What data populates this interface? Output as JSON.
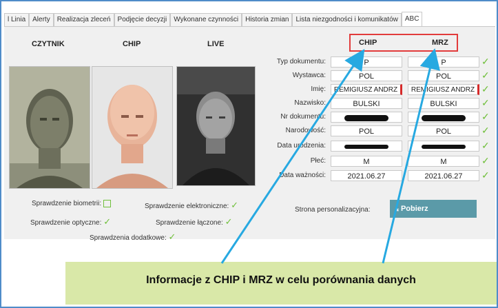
{
  "tabs": [
    "l Linia",
    "Alerty",
    "Realizacja zleceń",
    "Podjęcie decyzji",
    "Wykonane czynności",
    "Historia zmian",
    "Lista niezgodności i komunikatów",
    "ABC"
  ],
  "columns": {
    "czytnik": "CZYTNIK",
    "chip": "CHIP",
    "live": "LIVE"
  },
  "compare_headers": {
    "chip": "CHIP",
    "mrz": "MRZ"
  },
  "fields": [
    {
      "label": "Typ dokumentu:",
      "chip": "P",
      "mrz": "P",
      "redacted": false
    },
    {
      "label": "Wystawca:",
      "chip": "POL",
      "mrz": "POL",
      "redacted": false
    },
    {
      "label": "Imię:",
      "chip": "REMIGIUSZ ANDRZ",
      "mrz": "REMIGIUSZ ANDRZ",
      "redacted": false
    },
    {
      "label": "Nazwisko:",
      "chip": "BULSKI",
      "mrz": "BULSKI",
      "redacted": false
    },
    {
      "label": "Nr dokumentu:",
      "chip": "",
      "mrz": "",
      "redacted": true
    },
    {
      "label": "Narodowość:",
      "chip": "POL",
      "mrz": "POL",
      "redacted": false
    },
    {
      "label": "Data urodzenia:",
      "chip": "",
      "mrz": "",
      "redacted": true
    },
    {
      "label": "Płeć:",
      "chip": "M",
      "mrz": "M",
      "redacted": false
    },
    {
      "label": "Data ważności:",
      "chip": "2021.06.27",
      "mrz": "2021.06.27",
      "redacted": false
    }
  ],
  "checks": {
    "biometric": "Sprawdzenie biometrii:",
    "electronic": "Sprawdzenie elektroniczne:",
    "optical": "Sprawdzenie optyczne:",
    "combined": "Sprawdzenie łączone:",
    "additional": "Sprawdzenia dodatkowe:"
  },
  "personalization_label": "Strona personalizacyjna:",
  "pobierz_label": "Pobierz",
  "callout_text": "Informacje z CHIP i MRZ w celu porównania danych",
  "colors": {
    "highlight": "#e23b3b",
    "arrow": "#27a9e1",
    "callout": "#d9e8a8",
    "ok": "#6fbf3a",
    "button": "#5b9aa8"
  }
}
